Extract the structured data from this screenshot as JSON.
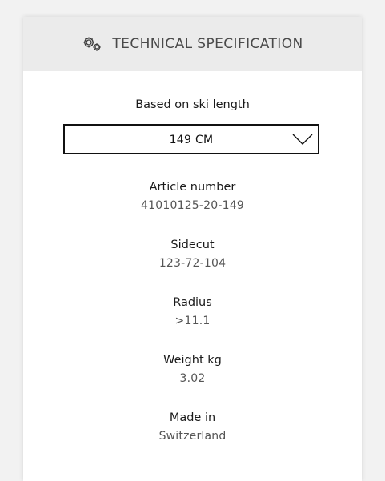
{
  "header": {
    "icon": "gears-icon",
    "title": "TECHNICAL SPECIFICATION"
  },
  "length_selector": {
    "label": "Based on ski length",
    "selected": "149 CM",
    "icon": "chevron-down-icon"
  },
  "specs": [
    {
      "label": "Article number",
      "value": "41010125-20-149"
    },
    {
      "label": "Sidecut",
      "value": "123-72-104"
    },
    {
      "label": "Radius",
      "value": ">11.1"
    },
    {
      "label": "Weight kg",
      "value": "3.02"
    },
    {
      "label": "Made in",
      "value": "Switzerland"
    }
  ]
}
